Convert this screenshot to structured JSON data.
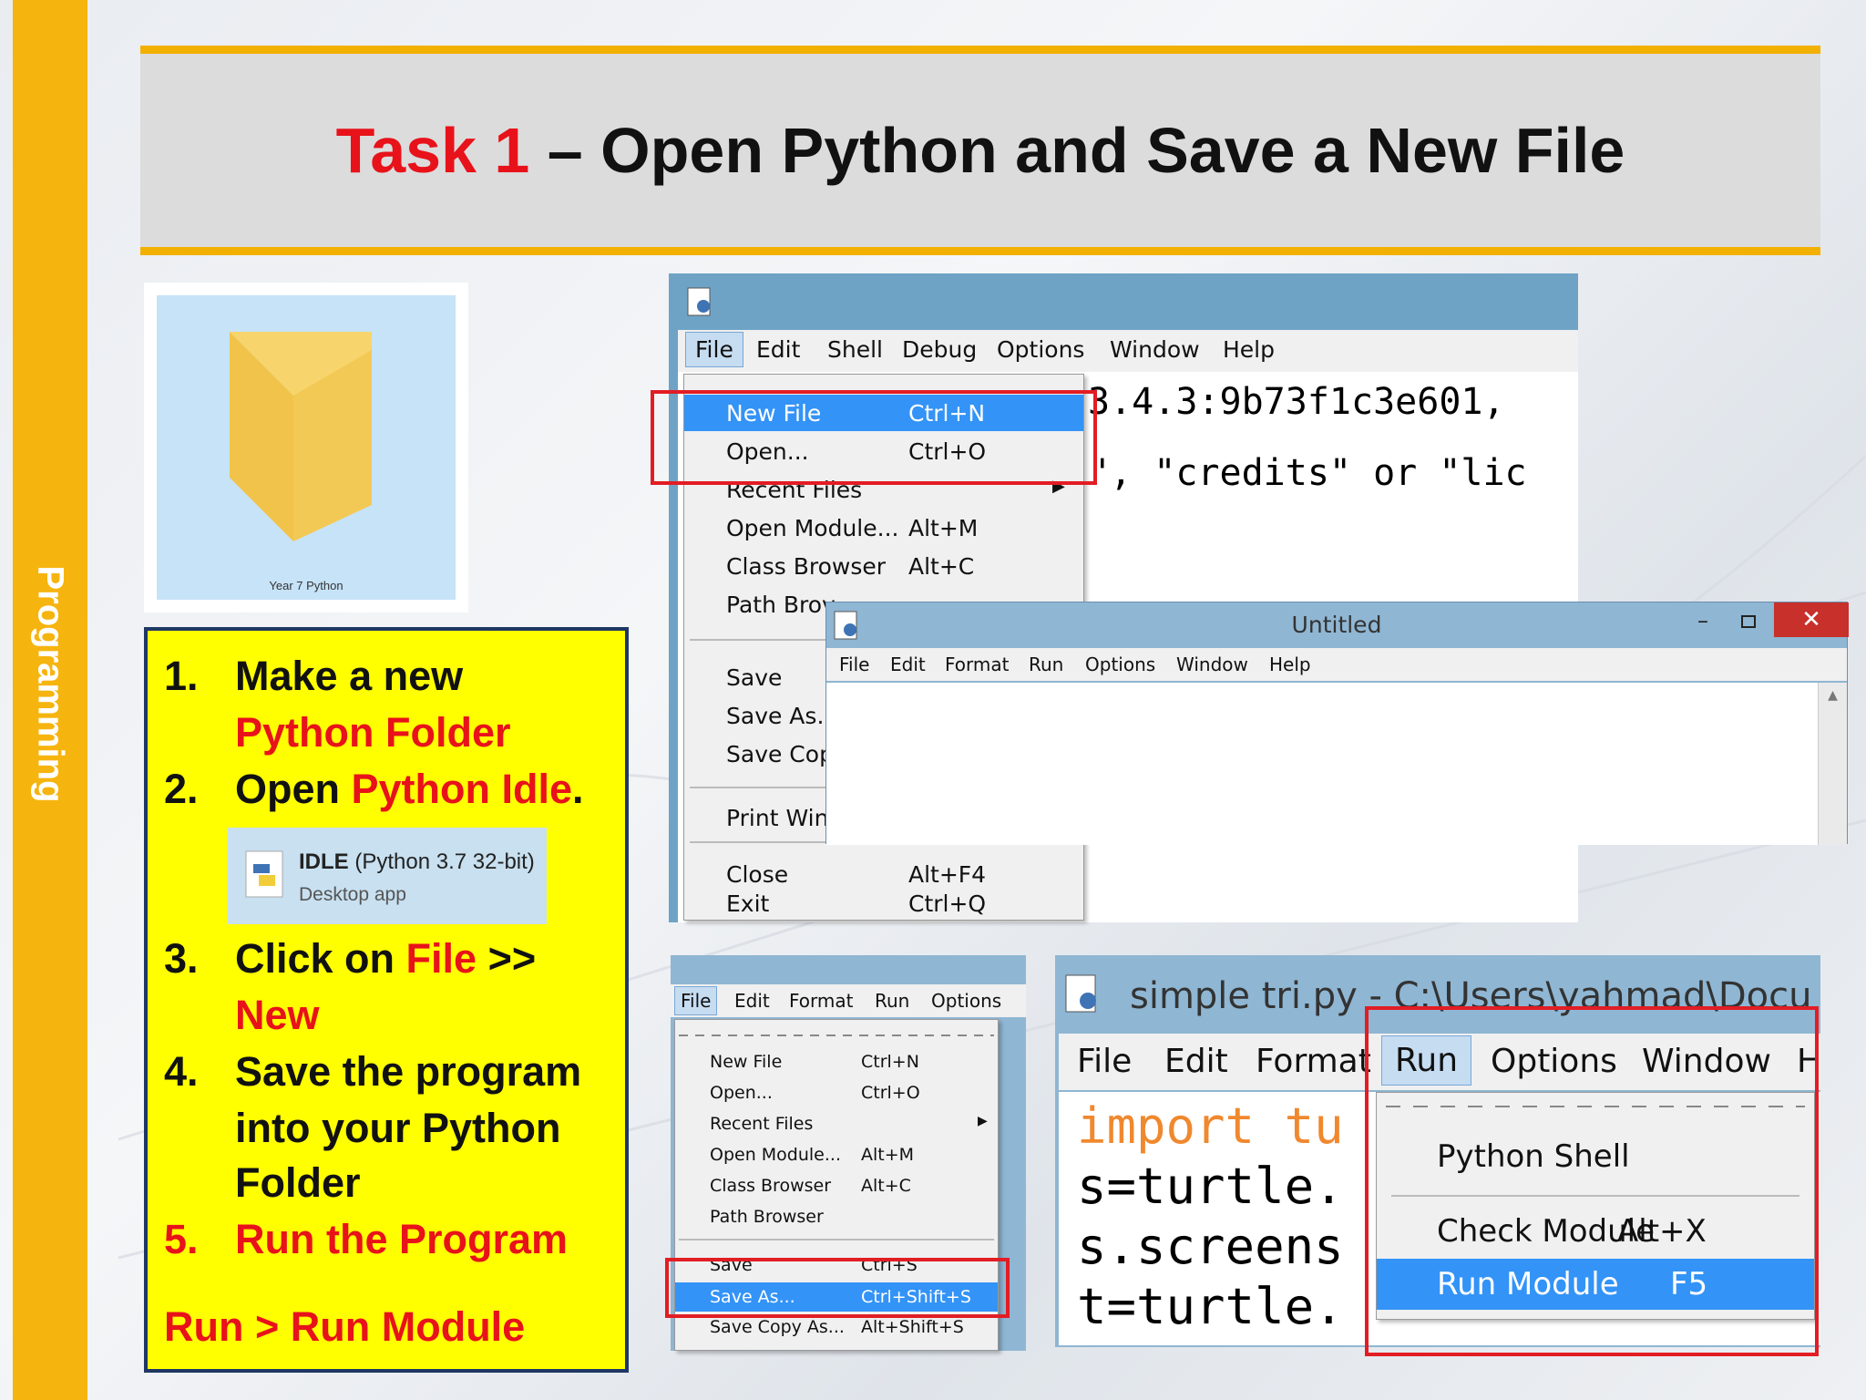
{
  "sidebar": {
    "label": "Programming"
  },
  "title": {
    "task": "Task 1",
    "rest": " – Open Python and Save a New File"
  },
  "folder": {
    "caption": "Year 7 Python"
  },
  "steps": {
    "s1_num": "1.",
    "s1_a": "Make a new",
    "s1_b": "Python Folder",
    "s2_num": "2.",
    "s2_a": "Open ",
    "s2_b": "Python Idle",
    "s2_c": ".",
    "idle": {
      "name": "IDLE",
      "version": " (Python 3.7 32-bit)",
      "sub": "Desktop app"
    },
    "s3_num": "3.",
    "s3_a": "Click on ",
    "s3_b": "File",
    "s3_c": " >>",
    "s3_d": "New",
    "s4_num": "4.",
    "s4_a": "Save the program",
    "s4_b": "into your Python",
    "s4_c": "Folder",
    "s5_num": "5.",
    "s5_a": "Run the Program",
    "footer": "Run > Run Module"
  },
  "shell_window": {
    "menu": [
      "File",
      "Edit",
      "Shell",
      "Debug",
      "Options",
      "Window",
      "Help"
    ],
    "text_line1": "3.4.3:9b73f1c3e601,",
    "text_line2": "\", \"credits\" or \"lic",
    "file_menu": [
      {
        "label": "New File",
        "shortcut": "Ctrl+N"
      },
      {
        "label": "Open...",
        "shortcut": "Ctrl+O"
      },
      {
        "label": "Recent Files",
        "shortcut": ""
      },
      {
        "label": "Open Module...",
        "shortcut": "Alt+M"
      },
      {
        "label": "Class Browser",
        "shortcut": "Alt+C"
      },
      {
        "label": "Path Brov",
        "shortcut": ""
      },
      {
        "label": "Save",
        "shortcut": ""
      },
      {
        "label": "Save As...",
        "shortcut": ""
      },
      {
        "label": "Save Cop",
        "shortcut": ""
      },
      {
        "label": "Print Win",
        "shortcut": ""
      },
      {
        "label": "Close",
        "shortcut": "Alt+F4"
      },
      {
        "label": "Exit",
        "shortcut": "Ctrl+Q"
      }
    ]
  },
  "untitled_window": {
    "title": "Untitled",
    "menu": [
      "File",
      "Edit",
      "Format",
      "Run",
      "Options",
      "Window",
      "Help"
    ]
  },
  "save_window": {
    "menu": [
      "File",
      "Edit",
      "Format",
      "Run",
      "Options"
    ],
    "file_menu": [
      {
        "label": "New File",
        "shortcut": "Ctrl+N"
      },
      {
        "label": "Open...",
        "shortcut": "Ctrl+O"
      },
      {
        "label": "Recent Files",
        "shortcut": ""
      },
      {
        "label": "Open Module...",
        "shortcut": "Alt+M"
      },
      {
        "label": "Class Browser",
        "shortcut": "Alt+C"
      },
      {
        "label": "Path Browser",
        "shortcut": ""
      },
      {
        "label": "Save",
        "shortcut": "Ctrl+S"
      },
      {
        "label": "Save As...",
        "shortcut": "Ctrl+Shift+S"
      },
      {
        "label": "Save Copy As...",
        "shortcut": "Alt+Shift+S"
      }
    ]
  },
  "run_window": {
    "title": "simple tri.py - C:\\Users\\yahmad\\Docum",
    "menu": [
      "File",
      "Edit",
      "Format",
      "Run",
      "Options",
      "Window",
      "H"
    ],
    "code": [
      "import tu",
      "s=turtle.",
      "s.screens",
      "t=turtle."
    ],
    "run_menu": [
      {
        "label": "Python Shell",
        "shortcut": ""
      },
      {
        "label": "Check Module",
        "shortcut": "Alt+X"
      },
      {
        "label": "Run Module",
        "shortcut": "F5"
      }
    ]
  }
}
